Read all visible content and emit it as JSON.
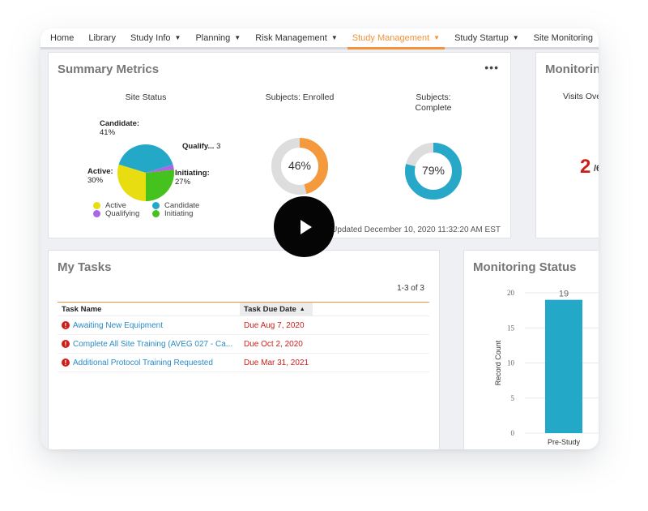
{
  "nav": {
    "items": [
      {
        "label": "Home",
        "caret": false,
        "active": false
      },
      {
        "label": "Library",
        "caret": false,
        "active": false
      },
      {
        "label": "Study Info",
        "caret": true,
        "active": false
      },
      {
        "label": "Planning",
        "caret": true,
        "active": false
      },
      {
        "label": "Risk Management",
        "caret": true,
        "active": false
      },
      {
        "label": "Study Management",
        "caret": true,
        "active": true
      },
      {
        "label": "Study Startup",
        "caret": true,
        "active": false
      },
      {
        "label": "Site Monitoring",
        "caret": false,
        "active": false
      }
    ],
    "accent_color": "#f3923a"
  },
  "summary": {
    "title": "Summary Metrics",
    "more_label": "•••",
    "last_updated": "Last Updated December 10, 2020 11:32:20 AM EST",
    "site_status": {
      "title": "Site Status",
      "labels": {
        "candidate": {
          "name": "Candidate:",
          "value": "41%"
        },
        "qualifying": {
          "name": "Qualify...",
          "value": "3"
        },
        "active": {
          "name": "Active:",
          "value": "30%"
        },
        "initiating": {
          "name": "Initiating:",
          "value": "27%"
        }
      },
      "legend": [
        "Active",
        "Candidate",
        "Qualifying",
        "Initiating"
      ]
    },
    "enrolled": {
      "title": "Subjects: Enrolled",
      "label": "46%"
    },
    "complete": {
      "title_line1": "Subjects:",
      "title_line2": "Complete",
      "label": "79%"
    }
  },
  "monitoring_top": {
    "title": "Monitorin",
    "visits_label": "Visits Ove",
    "count": "2",
    "count_rest": "/6"
  },
  "tasks": {
    "title": "My Tasks",
    "count_label": "1-3 of 3",
    "columns": {
      "name": "Task Name",
      "due": "Task Due Date",
      "sort_icon": "▲"
    },
    "rows": [
      {
        "name": "Awaiting New Equipment",
        "due": "Due Aug 7, 2020"
      },
      {
        "name": "Complete All Site Training (AVEG 027 - Ca...",
        "due": "Due Oct 2, 2020"
      },
      {
        "name": "Additional Protocol Training Requested",
        "due": "Due Mar 31, 2021"
      }
    ]
  },
  "monitoring_status": {
    "title": "Monitoring Status"
  },
  "chart_data": [
    {
      "type": "pie",
      "title": "Site Status",
      "categories": [
        "Candidate",
        "Qualifying",
        "Initiating",
        "Active"
      ],
      "values": [
        41,
        3,
        27,
        30
      ],
      "value_unit": "percent",
      "colors": [
        "#23a9c7",
        "#a966e6",
        "#45c21e",
        "#e8dd10"
      ],
      "legend": [
        "Active",
        "Candidate",
        "Qualifying",
        "Initiating"
      ],
      "legend_placement": "bottom"
    },
    {
      "type": "pie",
      "title": "Subjects: Enrolled",
      "values": [
        46,
        54
      ],
      "categories": [
        "Enrolled",
        "Remaining"
      ],
      "colors": [
        "#f49a3c",
        "#dddddd"
      ],
      "center_label": "46%"
    },
    {
      "type": "pie",
      "title": "Subjects: Complete",
      "values": [
        79,
        21
      ],
      "categories": [
        "Complete",
        "Remaining"
      ],
      "colors": [
        "#27a8c8",
        "#dddddd"
      ],
      "center_label": "79%"
    },
    {
      "type": "bar",
      "title": "Monitoring Status",
      "categories": [
        "Pre-Study"
      ],
      "values": [
        19
      ],
      "data_labels": [
        "19"
      ],
      "ylabel": "Record Count",
      "xlabel": "",
      "ylim": [
        0,
        20
      ],
      "yticks": [
        0,
        5,
        10,
        15,
        20
      ],
      "grid": true,
      "color": "#23a9c7"
    }
  ]
}
